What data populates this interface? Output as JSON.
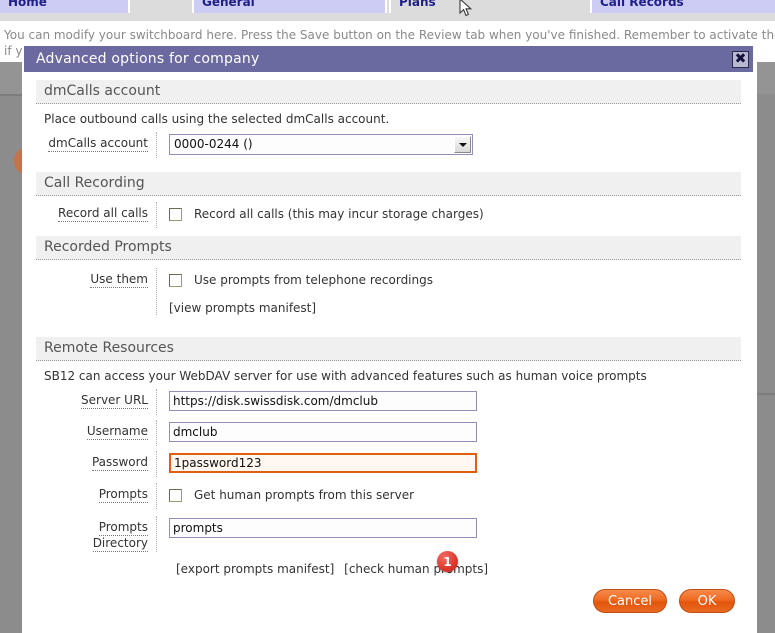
{
  "background": {
    "tabs": [
      {
        "id": "home",
        "label": "Home",
        "active": false
      },
      {
        "id": "general",
        "label": "General",
        "active": false
      },
      {
        "id": "plans",
        "label": "Plans",
        "active": true
      },
      {
        "id": "call-records",
        "label": "Call Records",
        "active": false
      }
    ],
    "instructions_line1": "You can modify your switchboard here. Press the Save button on the Review tab when you've finished. Remember to activate the plan",
    "instructions_line2": "if y"
  },
  "dialog": {
    "title": "Advanced options for company",
    "close_icon": "close-icon",
    "sections": {
      "dmcalls": {
        "header": "dmCalls account",
        "description": "Place outbound calls using the selected dmCalls account.",
        "account_label": "dmCalls account",
        "account_value": "0000-0244 ()"
      },
      "call_recording": {
        "header": "Call Recording",
        "record_label": "Record all calls",
        "record_checkbox_text": "Record all calls (this may incur storage charges)",
        "record_checked": false
      },
      "recorded_prompts": {
        "header": "Recorded Prompts",
        "use_label": "Use them",
        "use_checkbox_text": "Use prompts from telephone recordings",
        "use_checked": false,
        "view_manifest_link": "[view prompts manifest]"
      },
      "remote_resources": {
        "header": "Remote Resources",
        "description": "SB12 can access your WebDAV server for use with advanced features such as human voice prompts",
        "server_url_label": "Server URL",
        "server_url_value": "https://disk.swissdisk.com/dmclub",
        "username_label": "Username",
        "username_value": "dmclub",
        "password_label": "Password",
        "password_value": "1password123",
        "password_focused": true,
        "prompts_label": "Prompts",
        "prompts_checkbox_text": "Get human prompts from this server",
        "prompts_checked": false,
        "prompts_dir_label_line1": "Prompts",
        "prompts_dir_label_line2": "Directory",
        "prompts_dir_value": "prompts",
        "export_manifest_link": "[export prompts manifest]",
        "check_prompts_link": "[check human prompts]"
      }
    },
    "notification_badge": "1",
    "buttons": {
      "cancel": "Cancel",
      "ok": "OK"
    }
  },
  "colors": {
    "titlebar": "#6a6aa0",
    "tab_inactive": "#ccccf5",
    "tab_text": "#20208c",
    "accent_button": "#ef6a22",
    "focus_border": "#e06010",
    "badge": "#d93025"
  }
}
